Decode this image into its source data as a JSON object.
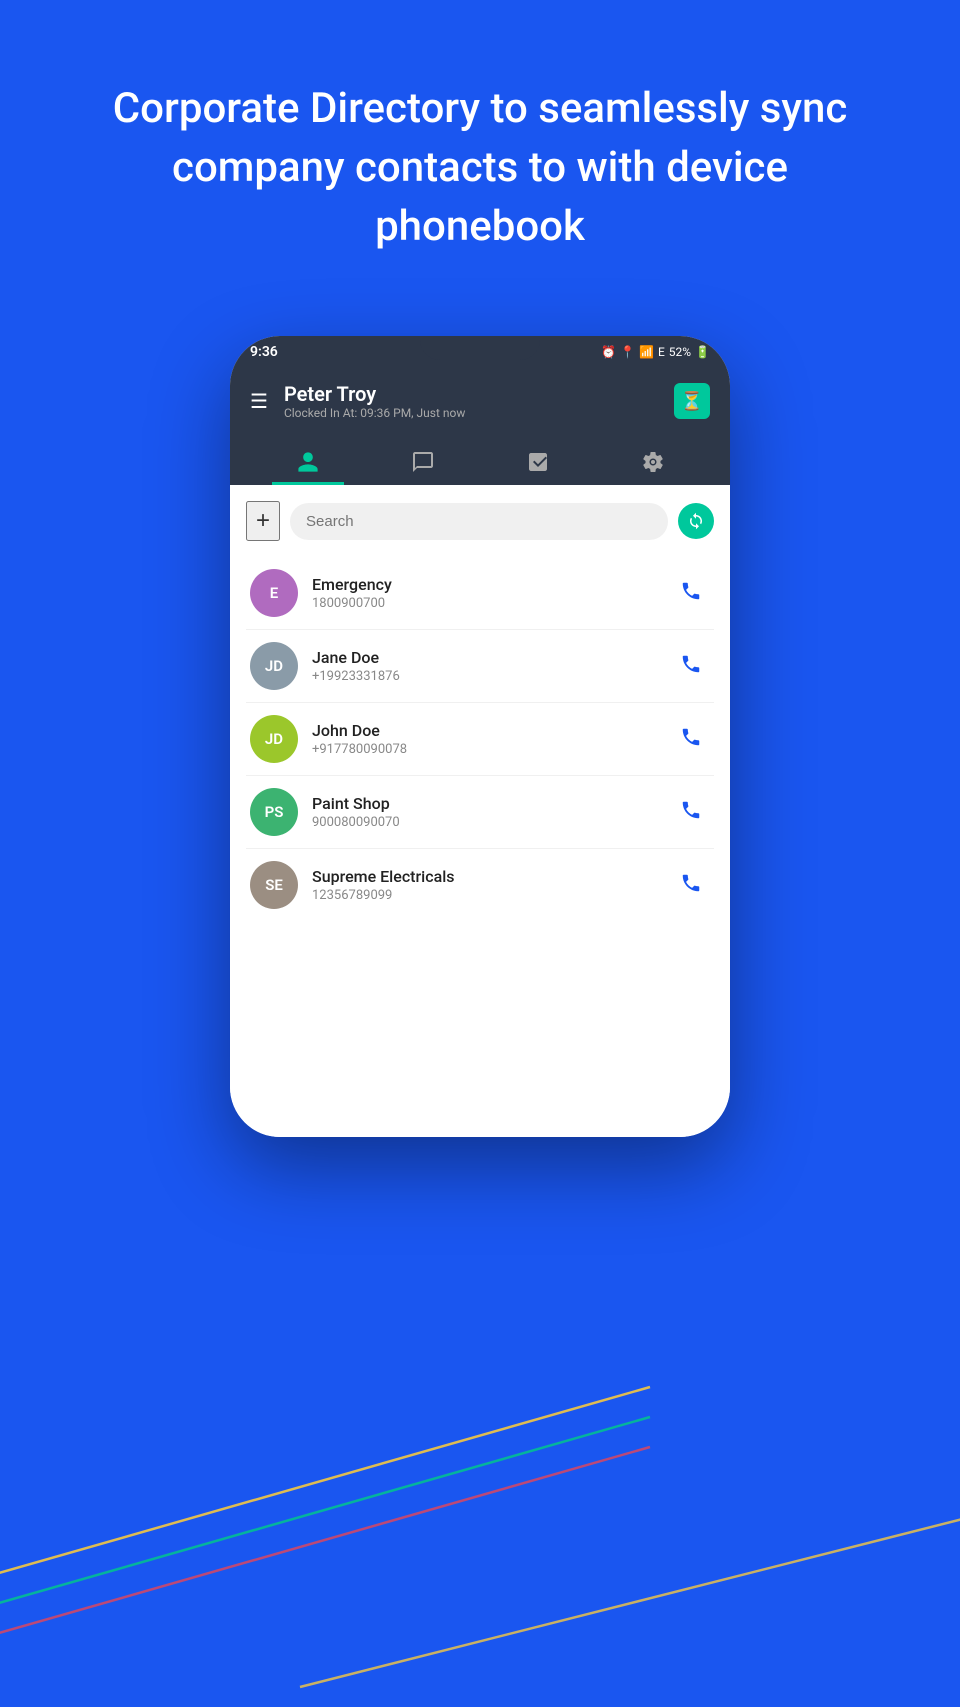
{
  "header": {
    "title": "Corporate Directory to seamlessly sync company contacts to with device phonebook"
  },
  "phone": {
    "status_bar": {
      "time": "9:36",
      "battery": "52%",
      "signal": "E"
    },
    "app_header": {
      "user_name": "Peter Troy",
      "clocked_in": "Clocked In At: 09:36 PM, Just now",
      "menu_label": "☰",
      "timer_icon": "⏳"
    },
    "tabs": [
      {
        "icon": "👤",
        "active": true,
        "label": "contacts-tab"
      },
      {
        "icon": "💬",
        "active": false,
        "label": "chat-tab"
      },
      {
        "icon": "📋",
        "active": false,
        "label": "tasks-tab"
      },
      {
        "icon": "⚙",
        "active": false,
        "label": "settings-tab"
      }
    ],
    "search": {
      "placeholder": "Search",
      "add_label": "+",
      "sync_icon": "🔄"
    },
    "contacts": [
      {
        "initials": "E",
        "name": "Emergency",
        "phone": "1800900700",
        "avatar_class": "avatar-emergency"
      },
      {
        "initials": "JD",
        "name": "Jane Doe",
        "phone": "+19923331876",
        "avatar_class": "avatar-jd-gray"
      },
      {
        "initials": "JD",
        "name": "John Doe",
        "phone": "+917780090078",
        "avatar_class": "avatar-jd-green"
      },
      {
        "initials": "PS",
        "name": "Paint Shop",
        "phone": "900080090070",
        "avatar_class": "avatar-ps"
      },
      {
        "initials": "SE",
        "name": "Supreme Electricals",
        "phone": "12356789099",
        "avatar_class": "avatar-se"
      }
    ]
  }
}
